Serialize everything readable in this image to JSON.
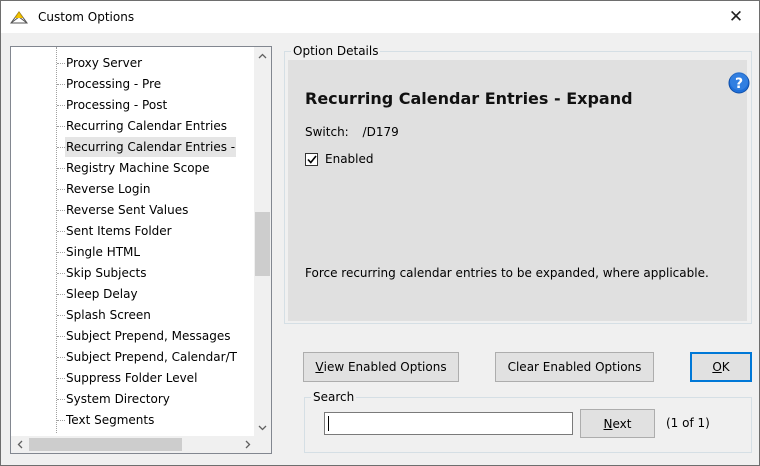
{
  "window": {
    "title": "Custom Options",
    "close_glyph": "✕"
  },
  "list": {
    "items": [
      {
        "label": "Proxy Server",
        "selected": false
      },
      {
        "label": "Processing - Pre",
        "selected": false
      },
      {
        "label": "Processing - Post",
        "selected": false
      },
      {
        "label": "Recurring Calendar Entries",
        "selected": false
      },
      {
        "label": "Recurring Calendar Entries -",
        "selected": true
      },
      {
        "label": "Registry Machine Scope",
        "selected": false
      },
      {
        "label": "Reverse Login",
        "selected": false
      },
      {
        "label": "Reverse Sent Values",
        "selected": false
      },
      {
        "label": "Sent Items Folder",
        "selected": false
      },
      {
        "label": "Single HTML",
        "selected": false
      },
      {
        "label": "Skip Subjects",
        "selected": false
      },
      {
        "label": "Sleep Delay",
        "selected": false
      },
      {
        "label": "Splash Screen",
        "selected": false
      },
      {
        "label": "Subject Prepend, Messages",
        "selected": false
      },
      {
        "label": "Subject Prepend, Calendar/T",
        "selected": false
      },
      {
        "label": "Suppress Folder Level",
        "selected": false
      },
      {
        "label": "System Directory",
        "selected": false
      },
      {
        "label": "Text Segments",
        "selected": false
      }
    ],
    "scroll_up": "^",
    "scroll_down": "v",
    "scroll_left": "<",
    "scroll_right": ">"
  },
  "details": {
    "legend": "Option Details",
    "title": "Recurring Calendar Entries - Expand",
    "switch_label": "Switch:",
    "switch_value": "/D179",
    "enabled_label": "Enabled",
    "enabled_checked": true,
    "description": "Force recurring calendar entries to be expanded, where applicable.",
    "help_icon": "help-icon",
    "help_color": "#1e6fd9"
  },
  "buttons": {
    "view_enabled": {
      "prefix": "",
      "accel": "V",
      "rest": "iew Enabled Options"
    },
    "clear_enabled": "Clear Enabled Options",
    "ok": {
      "accel": "O",
      "rest": "K"
    }
  },
  "search": {
    "legend": "Search",
    "value": "",
    "next": {
      "accel": "N",
      "rest": "ext"
    },
    "match_count": "(1 of 1)"
  }
}
